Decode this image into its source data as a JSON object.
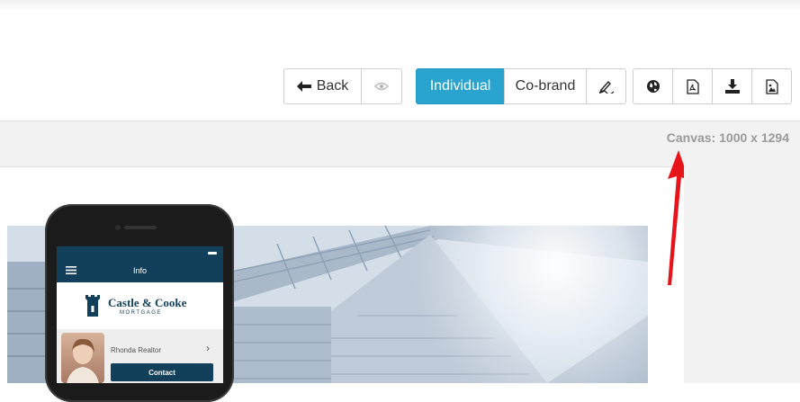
{
  "toolbar": {
    "back_label": "Back",
    "individual_label": "Individual",
    "cobrand_label": "Co-brand"
  },
  "canvas": {
    "label": "Canvas: 1000 x 1294"
  },
  "preview": {
    "header_title": "Info",
    "logo_name": "Castle & Cooke",
    "logo_sub": "MORTGAGE",
    "realtor_name": "Rhonda Realtor",
    "contact_label": "Contact"
  },
  "colors": {
    "accent": "#2aa3cf",
    "app_header": "#123f5a",
    "arrow": "#e8141c"
  }
}
